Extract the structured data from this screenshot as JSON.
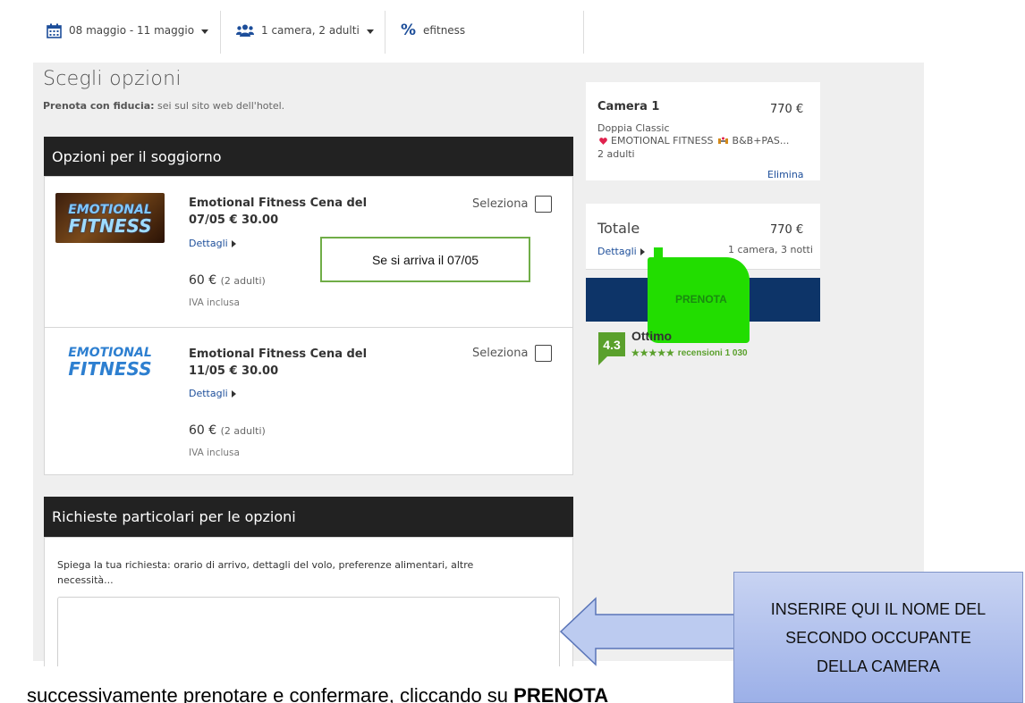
{
  "topbar": {
    "dates": "08 maggio - 11 maggio",
    "guests": "1 camera, 2 adulti",
    "promo_code": "efitness"
  },
  "page": {
    "title": "Scegli opzioni",
    "subtitle_bold": "Prenota con fiducia:",
    "subtitle_rest": " sei sul sito web dell'hotel."
  },
  "options_section": {
    "header": "Opzioni per il soggiorno",
    "items": [
      {
        "title_line1": "Emotional Fitness Cena del",
        "title_line2": "07/05 € 30.00",
        "details": "Dettagli",
        "price": "60 €",
        "price_note": "(2 adulti)",
        "vat": "IVA inclusa",
        "select_label": "Seleziona"
      },
      {
        "title_line1": "Emotional Fitness Cena del",
        "title_line2": "11/05 € 30.00",
        "details": "Dettagli",
        "price": "60 €",
        "price_note": "(2 adulti)",
        "vat": "IVA inclusa",
        "select_label": "Seleziona"
      }
    ],
    "annotation": "Se si arriva il 07/05"
  },
  "logo": {
    "line1": "EMOTIONAL",
    "line2": "FITNESS"
  },
  "requests_section": {
    "header": "Richieste particolari per le opzioni",
    "description_line1": "Spiega la tua richiesta: orario di arrivo, dettagli del volo, preferenze alimentari, altre",
    "description_line2": "necessità...",
    "textarea_value": ""
  },
  "summary": {
    "room_title": "Camera 1",
    "room_price": "770 €",
    "room_type": "Doppia Classic",
    "room_rate": "EMOTIONAL FITNESS",
    "room_rate_suffix": "B&B+PAS...",
    "room_guests": "2 adulti",
    "remove_label": "Elimina",
    "total_label": "Totale",
    "total_price": "770 €",
    "details_label": "Dettagli",
    "stay_summary": "1 camera, 3 notti",
    "book_button": "PRENOTA",
    "rating_score": "4.3",
    "rating_word": "Ottimo",
    "reviews": "recensioni 1 030"
  },
  "overlay": {
    "bottom_caption": "successivamente prenotare e confermare, cliccando su ",
    "bottom_caption_bold": "PRENOTA",
    "callout_line1": "INSERIRE QUI IL NOME DEL",
    "callout_line2": "SECONDO OCCUPANTE",
    "callout_line3": "DELLA CAMERA"
  },
  "colors": {
    "brand_blue": "#0d3468",
    "link_blue": "#1d4e9a",
    "highlight_green": "#22dd00",
    "rating_green": "#5aa02c",
    "heart_red": "#e0224e"
  }
}
